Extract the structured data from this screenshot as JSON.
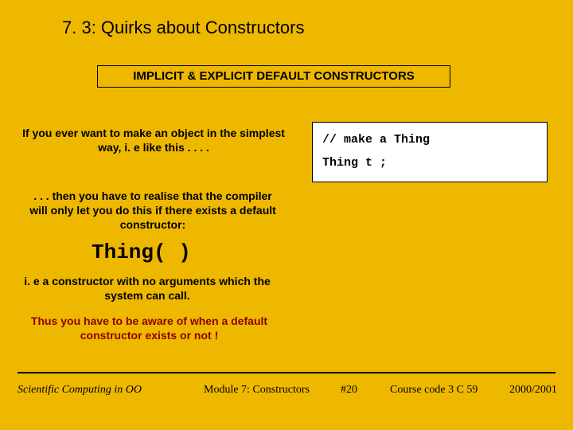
{
  "title": "7. 3: Quirks about Constructors",
  "subtitle": "IMPLICIT & EXPLICIT DEFAULT CONSTRUCTORS",
  "para1": "If you ever want to make an object in the simplest way, i. e like this . . . .",
  "code_line1": "// make a Thing",
  "code_line2": "Thing t   ;",
  "para2": ". . . then you have to realise that the compiler will only let you do this if there exists a default constructor:",
  "ctor": "Thing( )",
  "para3": "i. e a constructor with no arguments which the system can call.",
  "para4": "Thus you have to be aware of when a default constructor exists or not !",
  "footer": {
    "left": "Scientific Computing in OO",
    "mid1": "Module 7: Constructors",
    "mid2": "#20",
    "mid3": "Course code 3 C 59",
    "right": "2000/2001"
  }
}
